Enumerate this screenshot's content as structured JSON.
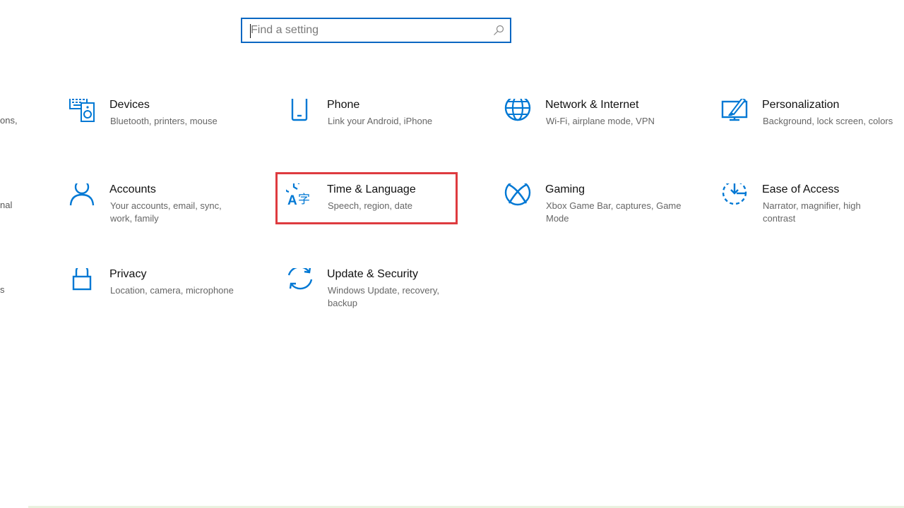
{
  "search": {
    "placeholder": "Find a setting"
  },
  "cutoff_fragments": [
    "ons,",
    "nal",
    "s"
  ],
  "tiles": [
    {
      "title": "Devices",
      "desc": "Bluetooth, printers, mouse",
      "icon": "devices-icon"
    },
    {
      "title": "Phone",
      "desc": "Link your Android, iPhone",
      "icon": "phone-icon"
    },
    {
      "title": "Network & Internet",
      "desc": "Wi-Fi, airplane mode, VPN",
      "icon": "globe-icon"
    },
    {
      "title": "Personalization",
      "desc": "Background, lock screen, colors",
      "icon": "paint-icon"
    },
    {
      "title": "Accounts",
      "desc": "Your accounts, email, sync, work, family",
      "icon": "person-icon"
    },
    {
      "title": "Time & Language",
      "desc": "Speech, region, date",
      "icon": "time-language-icon"
    },
    {
      "title": "Gaming",
      "desc": "Xbox Game Bar, captures, Game Mode",
      "icon": "xbox-icon"
    },
    {
      "title": "Ease of Access",
      "desc": "Narrator, magnifier, high contrast",
      "icon": "ease-of-access-icon"
    },
    {
      "title": "Privacy",
      "desc": "Location, camera, microphone",
      "icon": "lock-icon"
    },
    {
      "title": "Update & Security",
      "desc": "Windows Update, recovery, backup",
      "icon": "refresh-icon"
    }
  ],
  "colors": {
    "accent": "#0a67c2",
    "icon": "#0078d4",
    "highlight": "#de3b3f"
  }
}
